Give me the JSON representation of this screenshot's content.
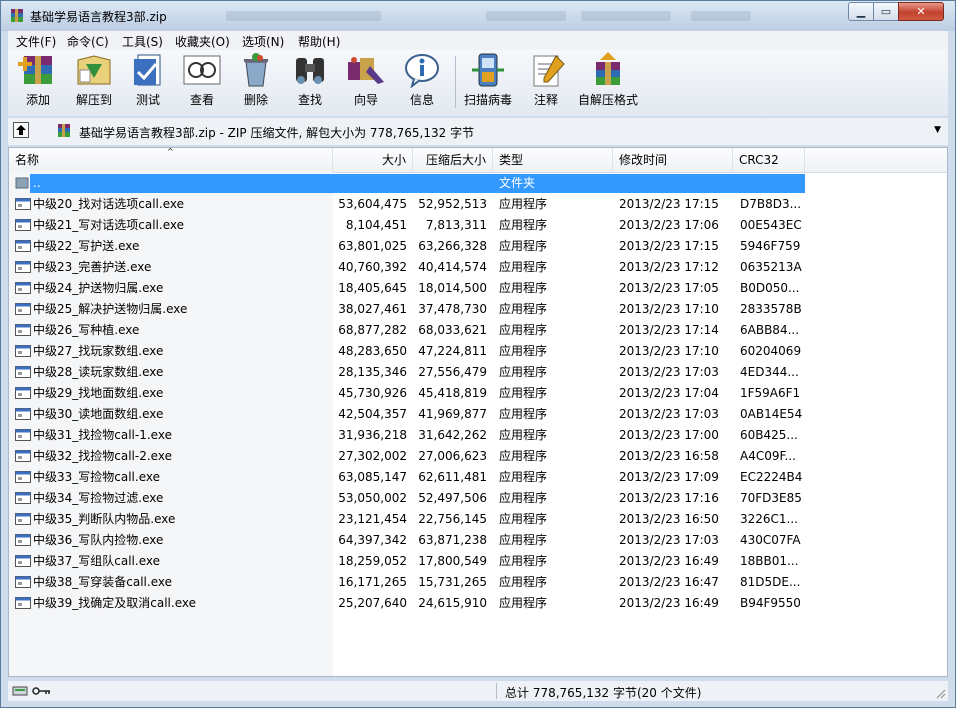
{
  "window": {
    "title": "基础学易语言教程3部.zip"
  },
  "menubar": {
    "items": [
      "文件(F)",
      "命令(C)",
      "工具(S)",
      "收藏夹(O)",
      "选项(N)",
      "帮助(H)"
    ]
  },
  "toolbar": {
    "buttons": [
      {
        "label": "添加",
        "icon": "add-archive-icon"
      },
      {
        "label": "解压到",
        "icon": "extract-to-icon"
      },
      {
        "label": "测试",
        "icon": "test-icon"
      },
      {
        "label": "查看",
        "icon": "view-icon"
      },
      {
        "label": "删除",
        "icon": "delete-icon"
      },
      {
        "label": "查找",
        "icon": "find-binoculars-icon"
      },
      {
        "label": "向导",
        "icon": "wizard-icon"
      },
      {
        "label": "信息",
        "icon": "info-icon"
      },
      {
        "label": "扫描病毒",
        "icon": "virus-scan-icon"
      },
      {
        "label": "注释",
        "icon": "comment-icon"
      },
      {
        "label": "自解压格式",
        "icon": "sfx-icon"
      }
    ]
  },
  "address": {
    "text": "基础学易语言教程3部.zip - ZIP 压缩文件, 解包大小为 778,765,132 字节"
  },
  "columns": [
    "名称",
    "大小",
    "压缩后大小",
    "类型",
    "修改时间",
    "CRC32"
  ],
  "parent_row": {
    "name": "..",
    "type": "文件夹"
  },
  "files": [
    {
      "name": "中级20_找对话选项call.exe",
      "size": "53,604,475",
      "packed": "52,952,513",
      "type": "应用程序",
      "modified": "2013/2/23 17:15",
      "crc": "D7B8D3..."
    },
    {
      "name": "中级21_写对话选项call.exe",
      "size": "8,104,451",
      "packed": "7,813,311",
      "type": "应用程序",
      "modified": "2013/2/23 17:06",
      "crc": "00E543EC"
    },
    {
      "name": "中级22_写护送.exe",
      "size": "63,801,025",
      "packed": "63,266,328",
      "type": "应用程序",
      "modified": "2013/2/23 17:15",
      "crc": "5946F759"
    },
    {
      "name": "中级23_完善护送.exe",
      "size": "40,760,392",
      "packed": "40,414,574",
      "type": "应用程序",
      "modified": "2013/2/23 17:12",
      "crc": "0635213A"
    },
    {
      "name": "中级24_护送物归属.exe",
      "size": "18,405,645",
      "packed": "18,014,500",
      "type": "应用程序",
      "modified": "2013/2/23 17:05",
      "crc": "B0D050..."
    },
    {
      "name": "中级25_解决护送物归属.exe",
      "size": "38,027,461",
      "packed": "37,478,730",
      "type": "应用程序",
      "modified": "2013/2/23 17:10",
      "crc": "2833578B"
    },
    {
      "name": "中级26_写种植.exe",
      "size": "68,877,282",
      "packed": "68,033,621",
      "type": "应用程序",
      "modified": "2013/2/23 17:14",
      "crc": "6ABB84..."
    },
    {
      "name": "中级27_找玩家数组.exe",
      "size": "48,283,650",
      "packed": "47,224,811",
      "type": "应用程序",
      "modified": "2013/2/23 17:10",
      "crc": "60204069"
    },
    {
      "name": "中级28_读玩家数组.exe",
      "size": "28,135,346",
      "packed": "27,556,479",
      "type": "应用程序",
      "modified": "2013/2/23 17:03",
      "crc": "4ED344..."
    },
    {
      "name": "中级29_找地面数组.exe",
      "size": "45,730,926",
      "packed": "45,418,819",
      "type": "应用程序",
      "modified": "2013/2/23 17:04",
      "crc": "1F59A6F1"
    },
    {
      "name": "中级30_读地面数组.exe",
      "size": "42,504,357",
      "packed": "41,969,877",
      "type": "应用程序",
      "modified": "2013/2/23 17:03",
      "crc": "0AB14E54"
    },
    {
      "name": "中级31_找捡物call-1.exe",
      "size": "31,936,218",
      "packed": "31,642,262",
      "type": "应用程序",
      "modified": "2013/2/23 17:00",
      "crc": "60B425..."
    },
    {
      "name": "中级32_找捡物call-2.exe",
      "size": "27,302,002",
      "packed": "27,006,623",
      "type": "应用程序",
      "modified": "2013/2/23 16:58",
      "crc": "A4C09F..."
    },
    {
      "name": "中级33_写捡物call.exe",
      "size": "63,085,147",
      "packed": "62,611,481",
      "type": "应用程序",
      "modified": "2013/2/23 17:09",
      "crc": "EC2224B4"
    },
    {
      "name": "中级34_写捡物过滤.exe",
      "size": "53,050,002",
      "packed": "52,497,506",
      "type": "应用程序",
      "modified": "2013/2/23 17:16",
      "crc": "70FD3E85"
    },
    {
      "name": "中级35_判断队内物品.exe",
      "size": "23,121,454",
      "packed": "22,756,145",
      "type": "应用程序",
      "modified": "2013/2/23 16:50",
      "crc": "3226C1..."
    },
    {
      "name": "中级36_写队内捡物.exe",
      "size": "64,397,342",
      "packed": "63,871,238",
      "type": "应用程序",
      "modified": "2013/2/23 17:03",
      "crc": "430C07FA"
    },
    {
      "name": "中级37_写组队call.exe",
      "size": "18,259,052",
      "packed": "17,800,549",
      "type": "应用程序",
      "modified": "2013/2/23 16:49",
      "crc": "18BB01..."
    },
    {
      "name": "中级38_写穿装备call.exe",
      "size": "16,171,265",
      "packed": "15,731,265",
      "type": "应用程序",
      "modified": "2013/2/23 16:47",
      "crc": "81D5DE..."
    },
    {
      "name": "中级39_找确定及取消call.exe",
      "size": "25,207,640",
      "packed": "24,615,910",
      "type": "应用程序",
      "modified": "2013/2/23 16:49",
      "crc": "B94F9550"
    }
  ],
  "status": {
    "text": "总计 778,765,132 字节(20 个文件)"
  },
  "colors": {
    "selection": "#3399ff",
    "title_bar": "#bccde2",
    "close_button": "#c2412d"
  }
}
